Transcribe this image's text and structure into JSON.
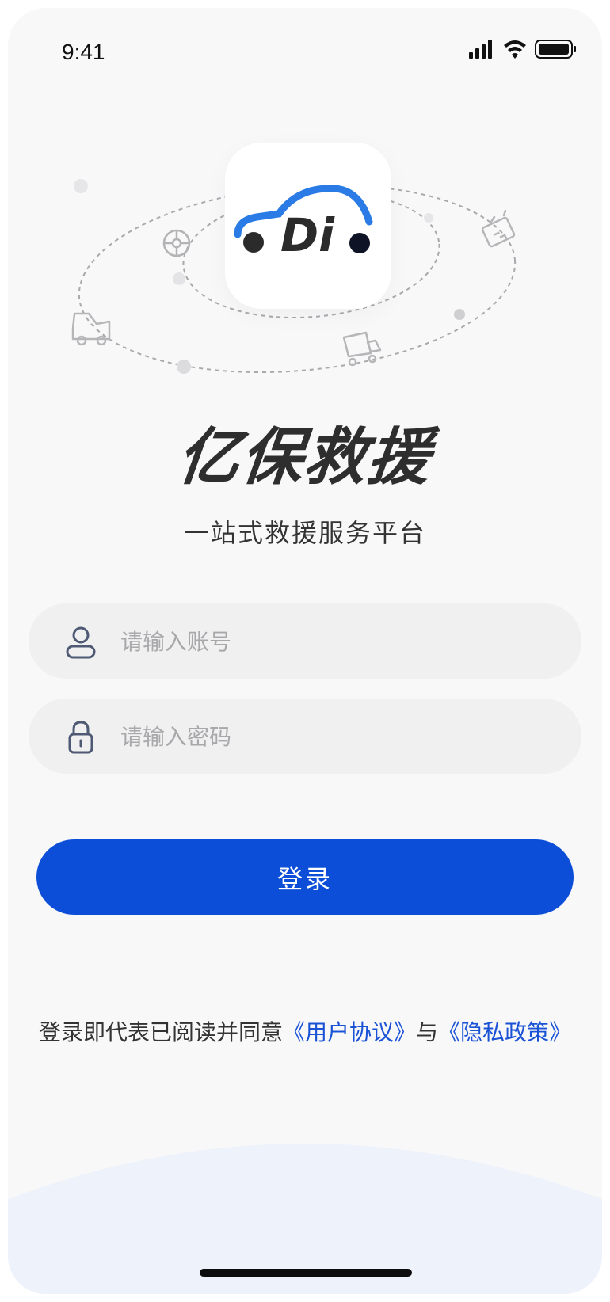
{
  "status_bar": {
    "time": "9:41",
    "signal_icon": "cellular-signal-icon",
    "wifi_icon": "wifi-icon",
    "battery_icon": "battery-icon"
  },
  "logo": {
    "icon": "car-wrench-logo-icon",
    "logo_text": "Di",
    "accent_color": "#2a7be6"
  },
  "brand": {
    "title": "亿保救援",
    "subtitle": "一站式救援服务平台"
  },
  "form": {
    "account": {
      "placeholder": "请输入账号",
      "icon": "user-icon"
    },
    "password": {
      "placeholder": "请输入密码",
      "icon": "lock-icon"
    },
    "login_label": "登录",
    "primary_color": "#0c4ed7"
  },
  "agreement": {
    "prefix": "登录即代表已阅读并同意",
    "user_agreement": "《用户协议》",
    "connector": "与",
    "privacy_policy": "《隐私政策》",
    "link_color": "#1a52d6"
  },
  "decorations": {
    "icons": [
      "wheel-icon",
      "tow-truck-icon",
      "delivery-truck-icon",
      "battery-decoration-icon"
    ]
  }
}
